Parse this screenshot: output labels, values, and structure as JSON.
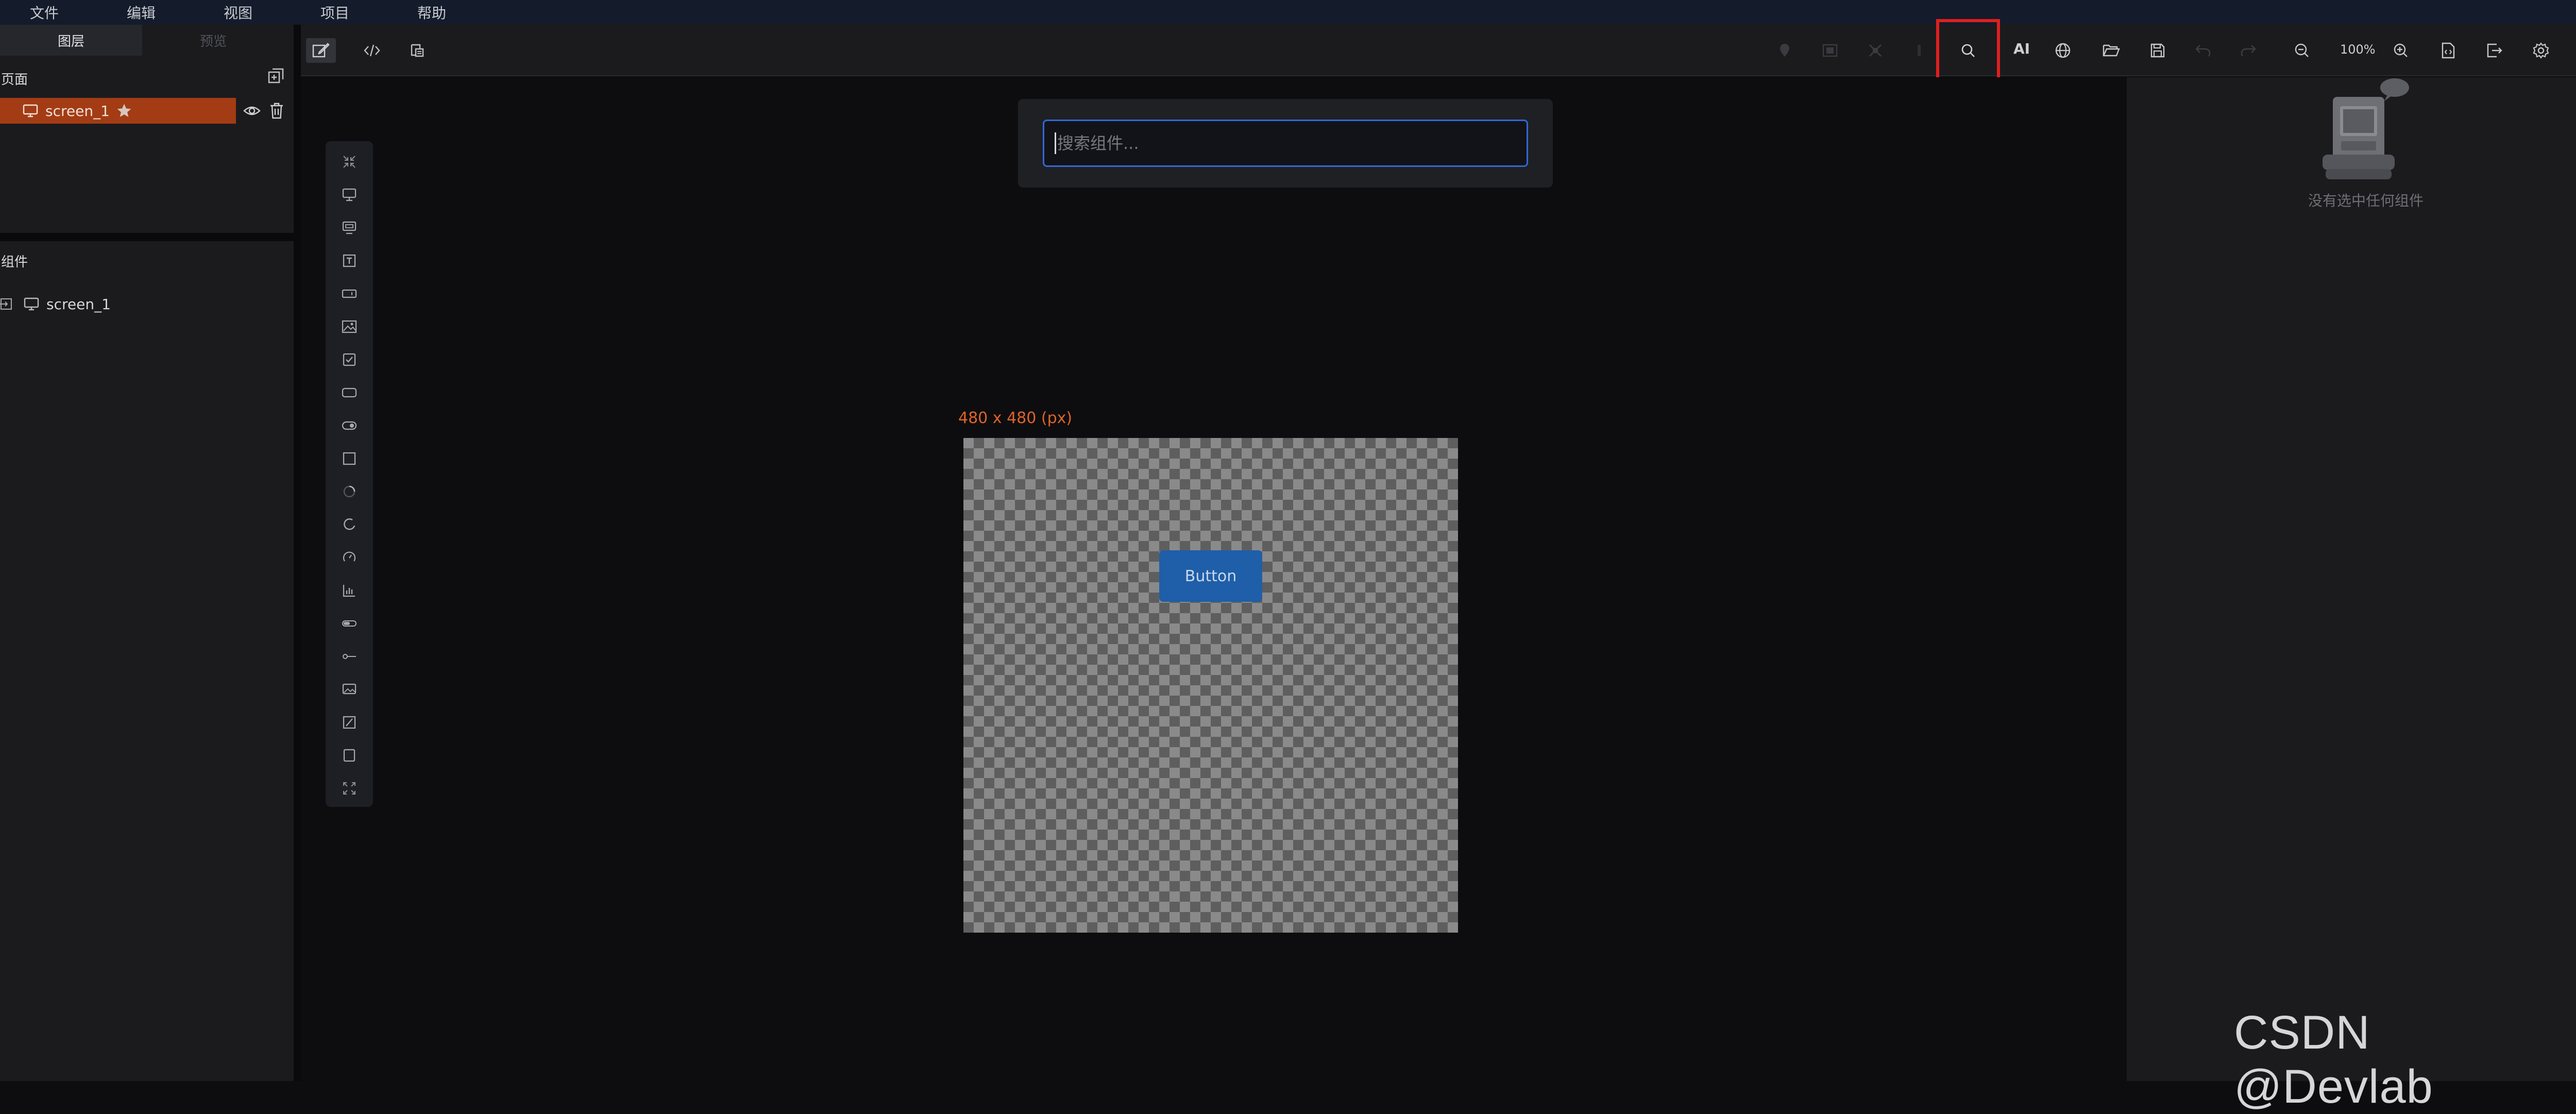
{
  "menu": [
    "文件",
    "编辑",
    "视图",
    "项目",
    "帮助"
  ],
  "left_panel": {
    "tabs": [
      "图层",
      "预览"
    ],
    "pages_label": "页面",
    "layer": {
      "name": "screen_1"
    },
    "components_label": "组件",
    "tree": [
      {
        "name": "screen_1"
      }
    ]
  },
  "toolbar": {
    "zoom": "100%",
    "ai_label": "AI",
    "highlight_color": "#e01f1f"
  },
  "search": {
    "placeholder": "搜索组件..."
  },
  "canvas": {
    "size_label": "480 x 480 (px)",
    "button_label": "Button"
  },
  "right_panel": {
    "empty_text": "没有选中任何组件"
  },
  "watermark": "CSDN @Devlab",
  "colors": {
    "accent": "#a33c14",
    "button": "#1f5ea8",
    "search_border": "#3068d4",
    "size_label": "#e0632a"
  }
}
